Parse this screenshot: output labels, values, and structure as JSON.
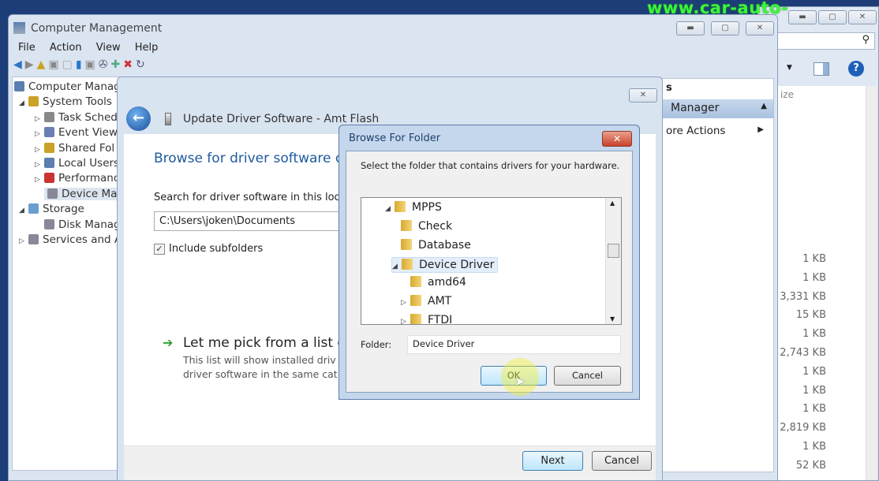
{
  "watermark": "www.car-auto-repair.com",
  "explorer": {
    "column_header": "ize",
    "sizes": [
      "1 KB",
      "1 KB",
      "3,331 KB",
      "15 KB",
      "1 KB",
      "2,743 KB",
      "1 KB",
      "1 KB",
      "1 KB",
      "2,819 KB",
      "1 KB",
      "52 KB"
    ]
  },
  "computer_management": {
    "title": "Computer Management",
    "menu": [
      "File",
      "Action",
      "View",
      "Help"
    ],
    "tree": [
      "Computer Manag",
      "System Tools",
      "Task Sched",
      "Event View",
      "Shared Fol",
      "Local Users",
      "Performanc",
      "Device Mar",
      "Storage",
      "Disk Manag",
      "Services and A"
    ],
    "actions": {
      "header": "s",
      "section": "Manager",
      "more": "ore Actions"
    }
  },
  "update_driver": {
    "title": "Update Driver Software - Amt Flash",
    "heading": "Browse for driver software c",
    "search_label": "Search for driver software in this loc",
    "path_value": "C:\\Users\\joken\\Documents",
    "include_subfolders": "Include subfolders",
    "include_subfolders_checked": true,
    "pick_title": "Let me pick from a list c",
    "pick_desc1": "This list will show installed driv",
    "pick_desc2": "driver software in the same cat",
    "next": "Next",
    "cancel": "Cancel"
  },
  "browse_folder": {
    "title": "Browse For Folder",
    "instruction": "Select the folder that contains drivers for your hardware.",
    "items": [
      "MPPS",
      "Check",
      "Database",
      "Device Driver",
      "amd64",
      "AMT",
      "FTDI"
    ],
    "selected": "Device Driver",
    "folder_label": "Folder:",
    "folder_value": "Device Driver",
    "ok": "OK",
    "cancel": "Cancel"
  },
  "colors": {
    "heading_blue": "#1e5a9e",
    "close_red": "#d9533a",
    "watermark_green": "#3cf53c",
    "arrow_green": "#2ea52e"
  }
}
